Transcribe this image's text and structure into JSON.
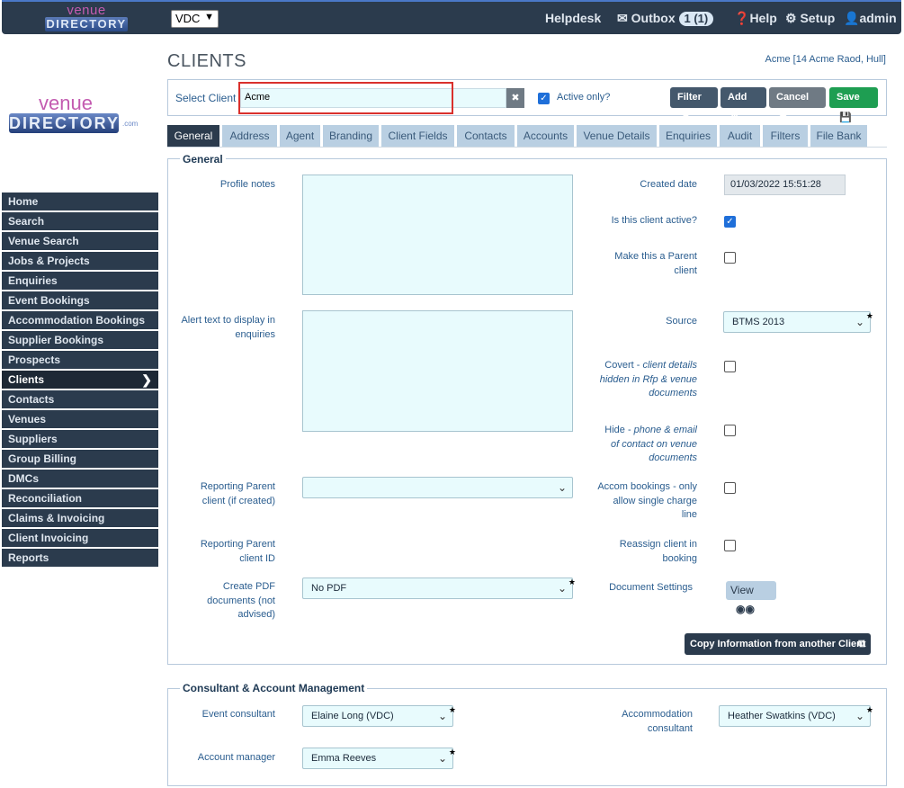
{
  "header": {
    "logo_top": "venue",
    "logo_bottom": "DIRECTORY",
    "org_select": "VDC",
    "helpdesk": "Helpdesk",
    "outbox": "Outbox",
    "outbox_badge": "1 (1)",
    "help": "Help",
    "setup": "Setup",
    "user": "admin"
  },
  "logo": {
    "top": "venue",
    "bottom": "DIRECTORY",
    "suffix": ".com"
  },
  "sidebar": {
    "items": [
      {
        "label": "Home"
      },
      {
        "label": "Search"
      },
      {
        "label": "Venue Search"
      },
      {
        "label": "Jobs & Projects"
      },
      {
        "label": "Enquiries"
      },
      {
        "label": "Event Bookings"
      },
      {
        "label": "Accommodation Bookings"
      },
      {
        "label": "Supplier Bookings"
      },
      {
        "label": "Prospects"
      },
      {
        "label": "Clients"
      },
      {
        "label": "Contacts"
      },
      {
        "label": "Venues"
      },
      {
        "label": "Suppliers"
      },
      {
        "label": "Group Billing"
      },
      {
        "label": "DMCs"
      },
      {
        "label": "Reconciliation"
      },
      {
        "label": "Claims & Invoicing"
      },
      {
        "label": "Client Invoicing"
      },
      {
        "label": "Reports"
      }
    ]
  },
  "page": {
    "title": "CLIENTS",
    "address": "Acme [14 Acme Raod, Hull]"
  },
  "client_bar": {
    "label": "Select Client",
    "value": "Acme",
    "active_only_label": "Active only?",
    "filter": "Filter",
    "add": "Add",
    "cancel": "Cancel",
    "save": "Save"
  },
  "tabs": [
    {
      "label": "General"
    },
    {
      "label": "Address"
    },
    {
      "label": "Agent"
    },
    {
      "label": "Branding"
    },
    {
      "label": "Client Fields"
    },
    {
      "label": "Contacts"
    },
    {
      "label": "Accounts"
    },
    {
      "label": "Venue Details"
    },
    {
      "label": "Enquiries"
    },
    {
      "label": "Audit"
    },
    {
      "label": "Filters"
    },
    {
      "label": "File Bank"
    }
  ],
  "general": {
    "legend": "General",
    "profile_notes": "Profile notes",
    "alert_text_1": "Alert text to display in",
    "alert_text_2": "enquiries",
    "reporting_parent_1": "Reporting Parent",
    "reporting_parent_2": "client (if created)",
    "reporting_parent_id_1": "Reporting Parent",
    "reporting_parent_id_2": "client ID",
    "create_pdf_1": "Create PDF",
    "create_pdf_2": "documents (not",
    "create_pdf_3": "advised)",
    "create_pdf_value": "No PDF",
    "created_date_label": "Created date",
    "created_date_value": "01/03/2022 15:51:28",
    "is_active_label": "Is this client active?",
    "make_parent_1": "Make this a Parent",
    "make_parent_2": "client",
    "source_label": "Source",
    "source_value": "BTMS 2013",
    "covert_1": "Covert - ",
    "covert_1b": "client details",
    "covert_2": "hidden in Rfp & venue",
    "covert_3": "documents",
    "hide_1": "Hide - ",
    "hide_1b": "phone & email",
    "hide_2": "of contact on venue",
    "hide_3": "documents",
    "accom_1": "Accom bookings - only",
    "accom_2": "allow single charge",
    "accom_3": "line",
    "reassign_1": "Reassign client in",
    "reassign_2": "booking",
    "doc_settings": "Document Settings",
    "view": "View",
    "copy_info": "Copy Information from another Client"
  },
  "consultant": {
    "legend": "Consultant & Account Management",
    "event_consultant_label": "Event consultant",
    "event_consultant_value": "Elaine Long (VDC)",
    "account_manager_label": "Account manager",
    "account_manager_value": "Emma Reeves",
    "accom_consultant_1": "Accommodation",
    "accom_consultant_2": "consultant",
    "accom_consultant_value": "Heather Swatkins (VDC)"
  },
  "colors": {
    "navy": "#2b3b4d",
    "tab_inactive": "#b9cfe2",
    "save_green": "#1e9e52",
    "field_bg": "#e8fbfd",
    "highlight_red": "#d9302c"
  }
}
